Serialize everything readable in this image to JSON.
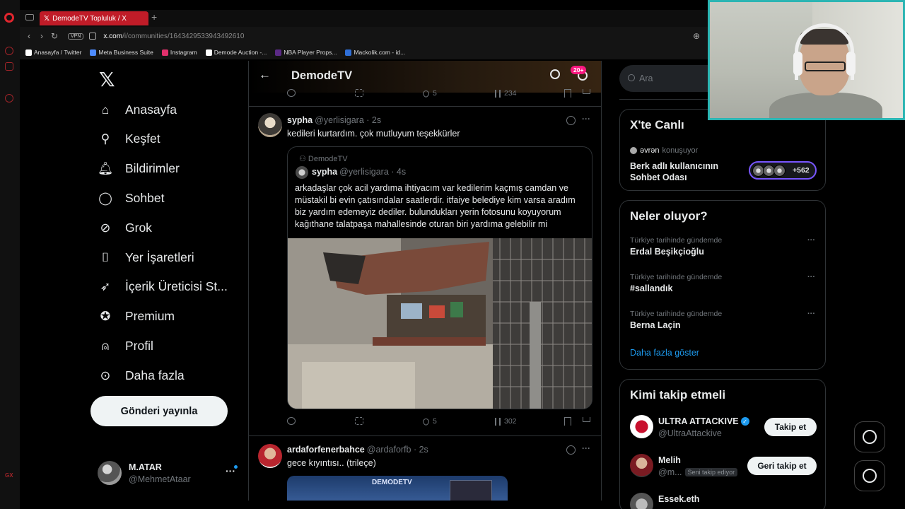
{
  "browser": {
    "tab_title": "DemodeTV Topluluk / X",
    "url_host": "x.com",
    "url_path": "/i/communities/1643429533943492610",
    "vpn_label": "VPN",
    "bookmarks": [
      {
        "label": "Anasayfa / Twitter",
        "color": "#ffffff"
      },
      {
        "label": "Meta Business Suite",
        "color": "#4e8cff"
      },
      {
        "label": "Instagram",
        "color": "#e1306c"
      },
      {
        "label": "Demode Auction -...",
        "color": "#ffffff"
      },
      {
        "label": "NBA Player Props...",
        "color": "#5b2a86"
      },
      {
        "label": "Mackolik.com - id...",
        "color": "#2f6fd8"
      }
    ]
  },
  "left_nav": {
    "items": [
      {
        "label": "Anasayfa",
        "icon": "home-icon"
      },
      {
        "label": "Keşfet",
        "icon": "search-icon"
      },
      {
        "label": "Bildirimler",
        "icon": "bell-icon"
      },
      {
        "label": "Sohbet",
        "icon": "chat-icon"
      },
      {
        "label": "Grok",
        "icon": "grok-icon"
      },
      {
        "label": "Yer İşaretleri",
        "icon": "bookmark-icon"
      },
      {
        "label": "İçerik Üreticisi St...",
        "icon": "rocket-icon"
      },
      {
        "label": "Premium",
        "icon": "verified-badge-icon"
      },
      {
        "label": "Profil",
        "icon": "person-icon"
      },
      {
        "label": "Daha fazla",
        "icon": "more-circle-icon"
      }
    ],
    "post_button": "Gönderi yayınla",
    "profile": {
      "name": "M.ATAR",
      "handle": "@MehmetAtaar",
      "more": "···"
    }
  },
  "center": {
    "header_title": "DemodeTV",
    "notification_badge": "20+",
    "top_actions": {
      "reply": "",
      "retweet": "",
      "likes": "5",
      "views": "234"
    },
    "tweet1": {
      "name": "sypha",
      "meta": "@yerlisigara · 2s",
      "text": "kedileri kurtardım. çok mutluyum teşekkürler",
      "quote": {
        "community": "DemodeTV",
        "name": "sypha",
        "meta": "@yerlisigara · 4s",
        "text": "arkadaşlar çok acil yardıma ihtiyacım var kedilerim kaçmış camdan ve müstakil bi evin çatısındalar saatlerdir. itfaiye belediye kim varsa aradım biz yardım edemeyiz dediler. bulundukları yerin fotosunu koyuyorum kağıthane talatpaşa mahallesinde oturan biri yardıma gelebilir mi"
      },
      "actions": {
        "likes": "5",
        "views": "302"
      }
    },
    "tweet2": {
      "name": "ardaforfenerbahce",
      "meta": "@ardaforfb · 2s",
      "text": "gece kıyıntısı.. (trileçe)",
      "image_caption": "DEMODETV"
    },
    "more_label": "···"
  },
  "right": {
    "search_placeholder": "Ara",
    "live": {
      "title": "X'te Canlı",
      "speaker": "əvrən",
      "speaker_suffix": "konuşuyor",
      "space_title": "Berk adlı kullanıcının Sohbet Odası",
      "listener_count": "+562"
    },
    "trends": {
      "title": "Neler oluyor?",
      "items": [
        {
          "context": "Türkiye tarihinde gündemde",
          "topic": "Erdal Beşikçioğlu"
        },
        {
          "context": "Türkiye tarihinde gündemde",
          "topic": "#sallandık"
        },
        {
          "context": "Türkiye tarihinde gündemde",
          "topic": "Berna Laçin"
        }
      ],
      "show_more": "Daha fazla göster"
    },
    "who_to_follow": {
      "title": "Kimi takip etmeli",
      "items": [
        {
          "name": "ULTRA ATTACKIVE",
          "handle": "@UltraAttackive",
          "button": "Takip et",
          "verified": true,
          "tag": ""
        },
        {
          "name": "Melih",
          "handle": "@m...",
          "button": "Geri takip et",
          "verified": false,
          "tag": "Seni takip ediyor"
        },
        {
          "name": "Essek.eth",
          "handle": "",
          "button": "",
          "verified": false,
          "tag": ""
        }
      ]
    }
  },
  "colors": {
    "accent": "#1d9bf0",
    "tab_red": "#c01c28",
    "badge_pink": "#f91880",
    "webcam_border": "#2bb5b3",
    "live_purple": "#7856ff"
  }
}
